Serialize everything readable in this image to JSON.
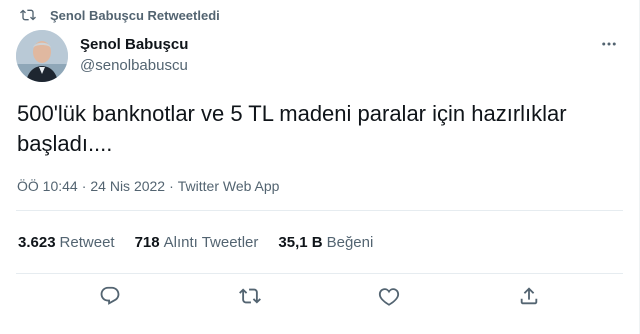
{
  "retweet_context": {
    "text": "Şenol Babuşcu Retweetledi",
    "icon": "retweet-icon"
  },
  "author": {
    "display_name": "Şenol Babuşcu",
    "handle": "@senolbabuscu"
  },
  "tweet": {
    "text": "500'lük banknotlar ve 5 TL madeni paralar için hazırlıklar başladı...."
  },
  "meta": {
    "time": "ÖÖ 10:44",
    "sep1": "·",
    "date": "24 Nis 2022",
    "sep2": "·",
    "source": "Twitter Web App"
  },
  "stats": [
    {
      "count": "3.623",
      "label": "Retweet"
    },
    {
      "count": "718",
      "label": "Alıntı Tweetler"
    },
    {
      "count": "35,1 B",
      "label": "Beğeni"
    }
  ],
  "actions": [
    "reply-icon",
    "retweet-icon",
    "like-icon",
    "share-icon"
  ],
  "colors": {
    "text_primary": "#0f1419",
    "text_secondary": "#536471",
    "divider": "#e6ecf0"
  }
}
